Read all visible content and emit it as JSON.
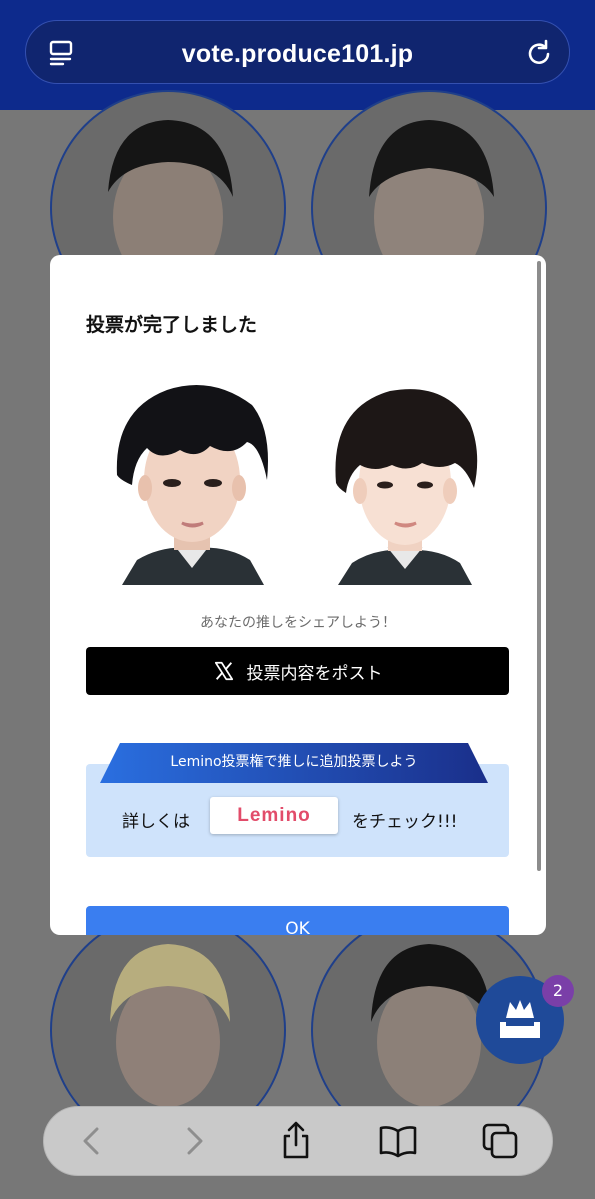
{
  "browser": {
    "url": "vote.produce101.jp",
    "icons": {
      "left": "reader-icon",
      "right": "reload-icon"
    }
  },
  "modal": {
    "title": "投票が完了しました",
    "share_text": "あなたの推しをシェアしよう！",
    "post_button": {
      "label": "投票内容をポスト",
      "icon": "x-logo-icon"
    },
    "lemino": {
      "banner": "Lemino投票権で推しに追加投票しよう",
      "prefix": "詳しくは",
      "logo_text": "Lemino",
      "suffix": "をチェック!!!"
    },
    "ok_label": "OK"
  },
  "fab": {
    "icon": "crown-ballot-icon",
    "badge": "2"
  },
  "toolbar": {
    "icons": [
      "back-icon",
      "forward-icon",
      "share-icon",
      "bookmarks-icon",
      "tabs-icon"
    ]
  },
  "colors": {
    "header": "#0d2a8c",
    "post_button": "#000000",
    "ok_button": "#3a7ef0",
    "lemino_box": "#cfe3fb",
    "badge": "#7a3fa8"
  }
}
